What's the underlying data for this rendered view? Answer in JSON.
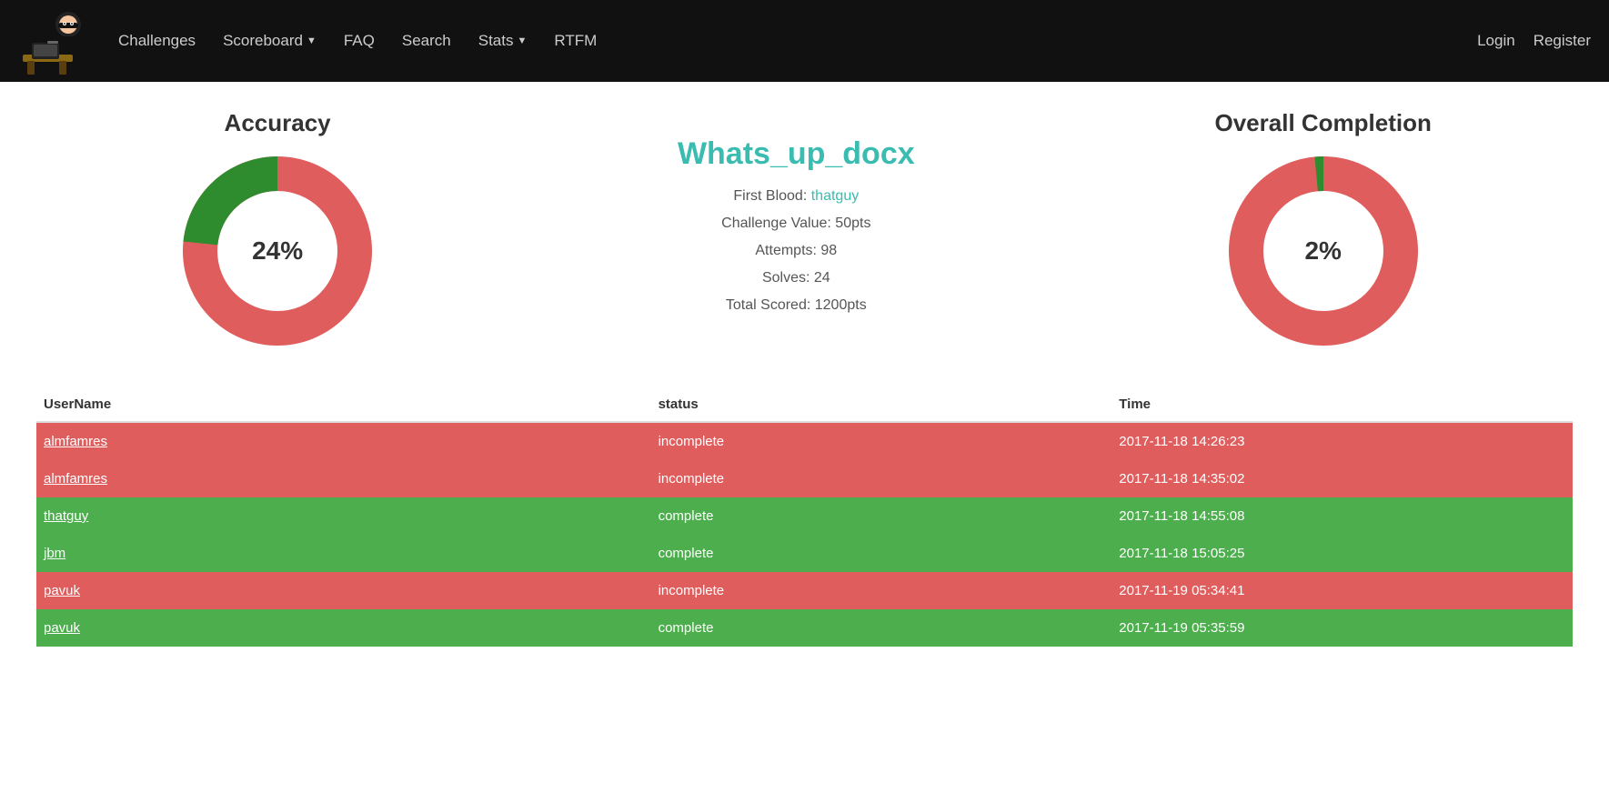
{
  "nav": {
    "links": [
      {
        "label": "Challenges",
        "href": "#",
        "dropdown": false
      },
      {
        "label": "Scoreboard",
        "href": "#",
        "dropdown": true
      },
      {
        "label": "FAQ",
        "href": "#",
        "dropdown": false
      },
      {
        "label": "Search",
        "href": "#",
        "dropdown": false
      },
      {
        "label": "Stats",
        "href": "#",
        "dropdown": true
      },
      {
        "label": "RTFM",
        "href": "#",
        "dropdown": false
      }
    ],
    "right_links": [
      {
        "label": "Login",
        "href": "#"
      },
      {
        "label": "Register",
        "href": "#"
      }
    ]
  },
  "accuracy_chart": {
    "title": "Accuracy",
    "percentage": 24,
    "label": "24%",
    "colors": {
      "green": "#2e8b2e",
      "red": "#e05d5d"
    }
  },
  "overall_chart": {
    "title": "Overall Completion",
    "percentage": 2,
    "label": "2%",
    "colors": {
      "green": "#2e8b2e",
      "red": "#e05d5d"
    }
  },
  "challenge": {
    "title": "Whats_up_docx",
    "first_blood_label": "First Blood:",
    "first_blood_user": "thatguy",
    "challenge_value_label": "Challenge Value:",
    "challenge_value": "50pts",
    "attempts_label": "Attempts:",
    "attempts": "98",
    "solves_label": "Solves:",
    "solves": "24",
    "total_scored_label": "Total Scored:",
    "total_scored": "1200pts"
  },
  "table": {
    "headers": {
      "username": "UserName",
      "status": "status",
      "time": "Time"
    },
    "rows": [
      {
        "username": "almfamres",
        "status": "incomplete",
        "time": "2017-11-18 14:26:23"
      },
      {
        "username": "almfamres",
        "status": "incomplete",
        "time": "2017-11-18 14:35:02"
      },
      {
        "username": "thatguy",
        "status": "complete",
        "time": "2017-11-18 14:55:08"
      },
      {
        "username": "jbm",
        "status": "complete",
        "time": "2017-11-18 15:05:25"
      },
      {
        "username": "pavuk",
        "status": "incomplete",
        "time": "2017-11-19 05:34:41"
      },
      {
        "username": "pavuk",
        "status": "complete",
        "time": "2017-11-19 05:35:59"
      }
    ]
  }
}
